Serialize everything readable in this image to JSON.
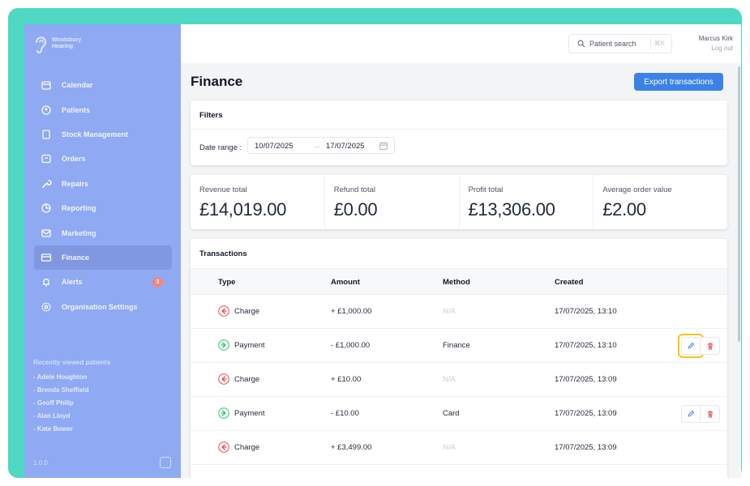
{
  "brand": {
    "name_line1": "Windsbury",
    "name_line2": "Hearing"
  },
  "sidebar": {
    "items": [
      {
        "label": "Calendar",
        "icon": "calendar-icon"
      },
      {
        "label": "Patients",
        "icon": "patients-icon"
      },
      {
        "label": "Stock Management",
        "icon": "stock-icon"
      },
      {
        "label": "Orders",
        "icon": "orders-icon"
      },
      {
        "label": "Repairs",
        "icon": "wrench-icon"
      },
      {
        "label": "Reporting",
        "icon": "chart-icon"
      },
      {
        "label": "Marketing",
        "icon": "mail-icon"
      },
      {
        "label": "Finance",
        "icon": "card-icon",
        "active": true
      },
      {
        "label": "Alerts",
        "icon": "bell-icon",
        "badge": "3"
      },
      {
        "label": "Organisation Settings",
        "icon": "gear-icon"
      }
    ],
    "recent_title": "Recently viewed patients",
    "recent": [
      "- Adele Houghton",
      "- Brenda Sheffield",
      "- Geoff Philip",
      "- Alan Lloyd",
      "- Kate Bower"
    ],
    "version": "1.0.0"
  },
  "topbar": {
    "search_placeholder": "Patient search",
    "search_shortcut": "⌘K",
    "user_name": "Marcus Kirk",
    "logout": "Log out"
  },
  "page": {
    "title": "Finance",
    "export_label": "Export transactions"
  },
  "filters": {
    "title": "Filters",
    "date_label": "Date range :",
    "date_from": "10/07/2025",
    "date_arrow": "→",
    "date_to": "17/07/2025"
  },
  "stats": [
    {
      "label": "Revenue total",
      "value": "£14,019.00"
    },
    {
      "label": "Refund total",
      "value": "£0.00"
    },
    {
      "label": "Profit total",
      "value": "£13,306.00"
    },
    {
      "label": "Average order value",
      "value": "£2.00"
    }
  ],
  "transactions": {
    "title": "Transactions",
    "columns": [
      "Type",
      "Amount",
      "Method",
      "Created"
    ],
    "rows": [
      {
        "type": "Charge",
        "amount": "+ £1,000.00",
        "method": "N/A",
        "created": "17/07/2025, 13:10",
        "actions": false
      },
      {
        "type": "Payment",
        "amount": "- £1,000.00",
        "method": "Finance",
        "created": "17/07/2025, 13:10",
        "actions": true,
        "highlight": true
      },
      {
        "type": "Charge",
        "amount": "+ £10.00",
        "method": "N/A",
        "created": "17/07/2025, 13:09",
        "actions": false
      },
      {
        "type": "Payment",
        "amount": "- £10.00",
        "method": "Card",
        "created": "17/07/2025, 13:09",
        "actions": true
      },
      {
        "type": "Charge",
        "amount": "+ £3,499.00",
        "method": "N/A",
        "created": "17/07/2025, 13:09",
        "actions": false
      }
    ]
  },
  "colors": {
    "frame": "#4fd8c4",
    "sidebar": "#8fa9f3",
    "primary": "#3b82e6",
    "charge": "#ef4444",
    "payment": "#22c55e",
    "highlight": "#f5c518"
  }
}
